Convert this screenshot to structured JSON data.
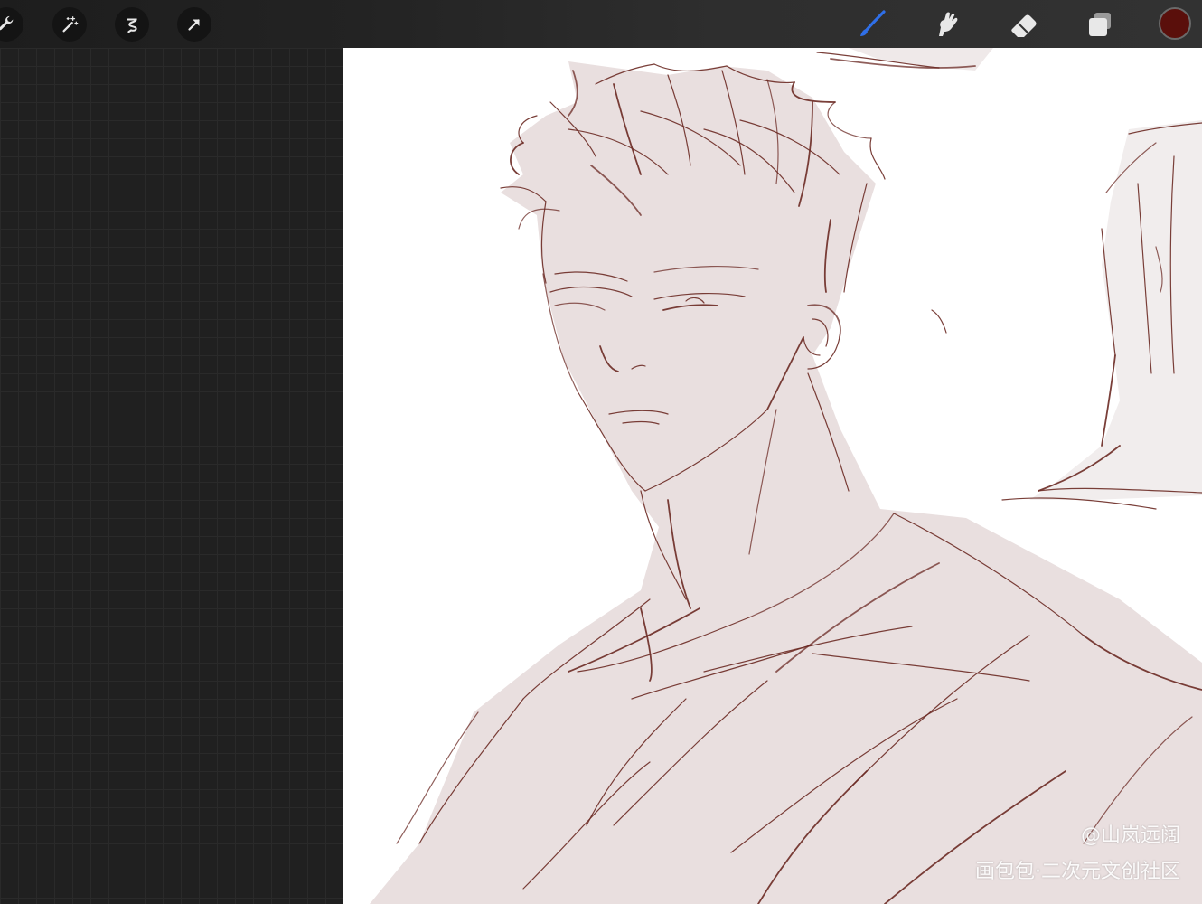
{
  "toolbar": {
    "left_tools": [
      {
        "name": "wrench-icon"
      },
      {
        "name": "magic-wand-icon"
      },
      {
        "name": "selection-icon"
      },
      {
        "name": "transform-arrow-icon"
      }
    ],
    "right_tools": [
      {
        "name": "brush-icon",
        "active": true
      },
      {
        "name": "smudge-icon"
      },
      {
        "name": "eraser-icon"
      },
      {
        "name": "layers-icon"
      }
    ],
    "current_color": "#5a0f0b",
    "active_tool_color": "#2f6fe8"
  },
  "canvas": {
    "background": "#ffffff",
    "sketch_line_color": "#6b2a24",
    "sketch_fill_color": "#e9dfdf"
  },
  "watermark": {
    "user": "@山岚远阔",
    "site": "画包包·二次元文创社区"
  }
}
